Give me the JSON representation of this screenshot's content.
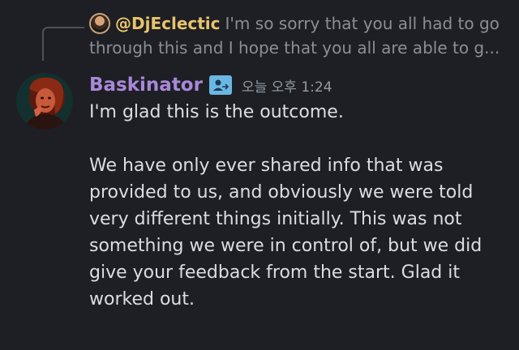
{
  "reply": {
    "author": "@DjEclectic",
    "avatar_icon": "user-avatar-icon",
    "text_line1": "I'm so sorry that you all had to go",
    "text_line2": "through this and I hope that you all are able to g..."
  },
  "message": {
    "author": "Baskinator",
    "author_color": "#a889d9",
    "role_icon": "role-badge-icon",
    "timestamp": "오늘 오후 1:24",
    "paragraph1": "I'm glad this is the outcome.",
    "paragraph2_lines": [
      "We have only ever shared info that was",
      "provided to us, and obviously we were told",
      "very different things initially. This was not",
      "something we were in control of, but we did",
      "give your feedback from the start. Glad it",
      "worked out."
    ]
  },
  "colors": {
    "background": "#1e1f24",
    "reply_author": "#e9c46a",
    "muted_text": "#8b8e95",
    "body_text": "#dbdee1",
    "role_badge": "#6bb7e3"
  }
}
